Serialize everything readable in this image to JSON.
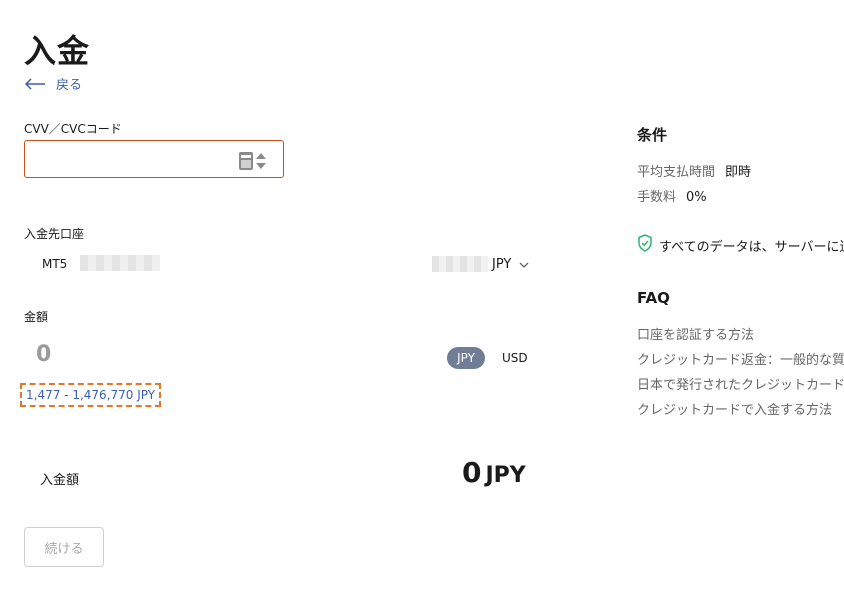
{
  "page": {
    "title": "入金"
  },
  "nav": {
    "back_label": "戻る"
  },
  "cvv": {
    "label": "CVV／CVCコード",
    "value": "",
    "placeholder": ""
  },
  "account": {
    "label": "入金先口座",
    "platform": "MT5",
    "currency": "JPY"
  },
  "amount": {
    "label": "金額",
    "value": "0",
    "currencies": [
      "JPY",
      "USD"
    ],
    "selected_currency": "JPY",
    "range": "1,477 - 1,476,770 JPY"
  },
  "total": {
    "label": "入金額",
    "value": "0",
    "currency": "JPY"
  },
  "actions": {
    "continue_label": "続ける"
  },
  "conditions": {
    "title": "条件",
    "rows": [
      {
        "key": "平均支払時間",
        "value": "即時"
      },
      {
        "key": "手数料",
        "value": "0%"
      }
    ],
    "security_text": "すべてのデータは、サーバーに送信"
  },
  "faq": {
    "title": "FAQ",
    "links": [
      "口座を認証する方法",
      "クレジットカード返金：一般的な質問",
      "日本で発行されたクレジットカードによ",
      "クレジットカードで入金する方法"
    ]
  },
  "colors": {
    "link": "#3c5fb3",
    "input_border": "#c8511b",
    "highlight_border": "#e07a2a",
    "currency_pill": "#6f7e94",
    "shield": "#2bb673"
  },
  "icons": [
    "back-arrow-icon",
    "card-cvv-icon",
    "chevron-down-icon",
    "shield-check-icon"
  ]
}
